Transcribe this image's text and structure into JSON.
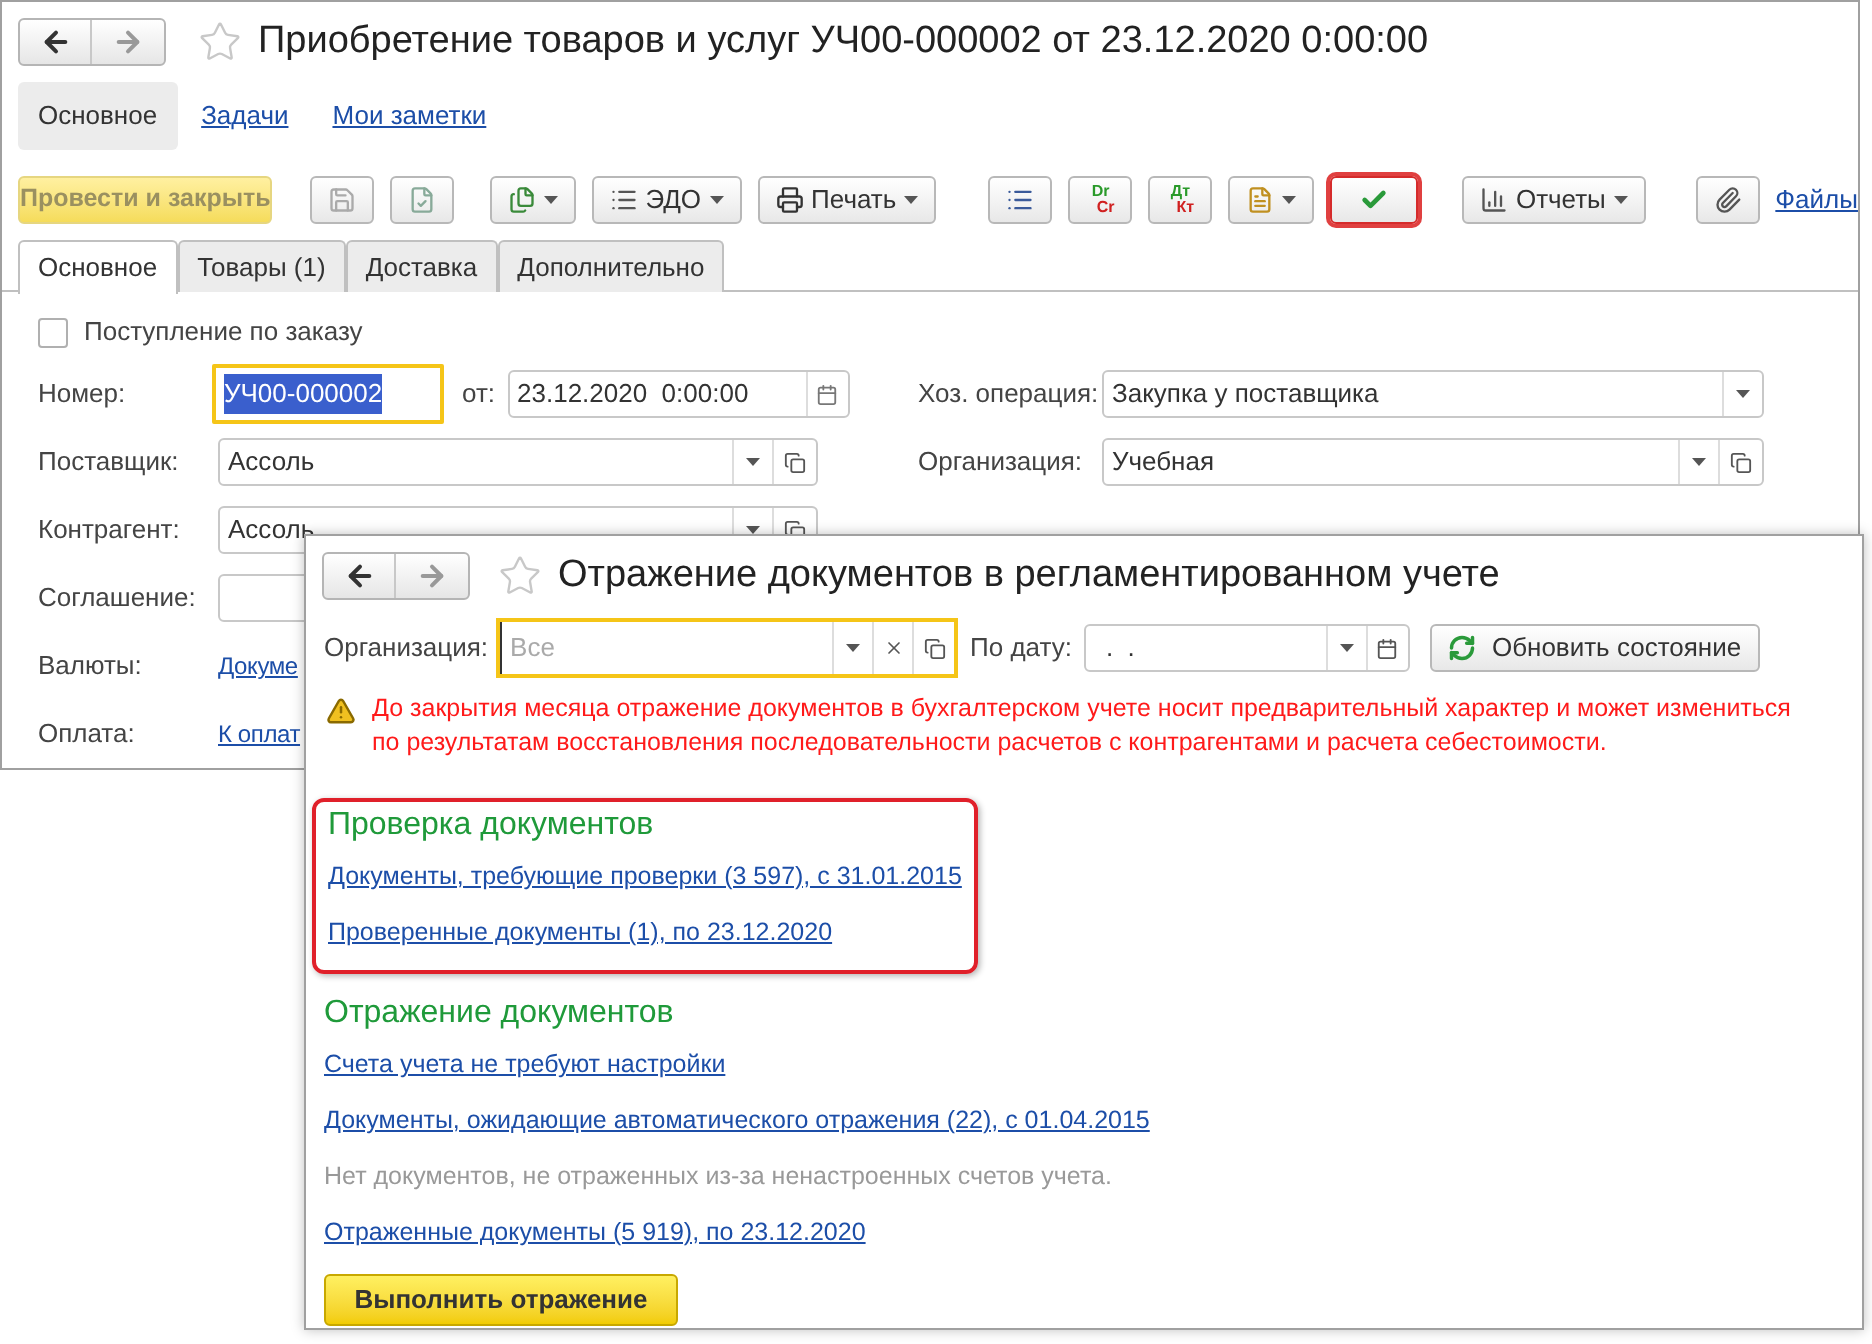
{
  "back_window": {
    "title": "Приобретение товаров и услуг УЧ00-000002 от 23.12.2020 0:00:00",
    "nav_tabs": [
      {
        "label": "Основное",
        "selected": true
      },
      {
        "label": "Задачи",
        "selected": false
      },
      {
        "label": "Мои заметки",
        "selected": false
      }
    ],
    "toolbar": {
      "post_button": "Провести и закрыть",
      "edo_button": "ЭДО",
      "print_button": "Печать",
      "dr_cr": [
        "Dr",
        "Cr"
      ],
      "dt_kt": [
        "Дт",
        "Кт"
      ],
      "check_highlighted": true,
      "reports_button": "Отчеты",
      "files_link": "Файлы"
    },
    "tabs": [
      {
        "label": "Основное",
        "selected": true
      },
      {
        "label": "Товары (1)",
        "selected": false
      },
      {
        "label": "Доставка",
        "selected": false
      },
      {
        "label": "Дополнительно",
        "selected": false
      }
    ],
    "order_checkbox": {
      "label": "Поступление по заказу",
      "checked": false
    },
    "number": {
      "label": "Номер:",
      "value": "УЧ00-000002",
      "focused": true
    },
    "date": {
      "label": "от:",
      "value": "23.12.2020  0:00:00"
    },
    "left_fields": [
      {
        "kind": "select",
        "label": "Поставщик:",
        "value": "Ассоль"
      },
      {
        "kind": "select",
        "label": "Контрагент:",
        "value": "Ассоль"
      },
      {
        "kind": "input",
        "label": "Соглашение:"
      },
      {
        "kind": "link",
        "label": "Валюты:",
        "value": "Докуме"
      },
      {
        "kind": "link",
        "label": "Оплата:",
        "value": "К оплат"
      }
    ],
    "right_fields": [
      {
        "kind": "dropdown",
        "label": "Хоз. операция:",
        "value": "Закупка у поставщика"
      },
      {
        "kind": "select",
        "label": "Организация:",
        "value": "Учебная"
      }
    ]
  },
  "front_window": {
    "title": "Отражение документов в регламентированном учете",
    "organization": {
      "label": "Организация:",
      "placeholder": "Все",
      "focused": true
    },
    "date": {
      "label": "По дату:",
      "value": ".  ."
    },
    "refresh_button": "Обновить состояние",
    "warning": "До закрытия месяца отражение документов в бухгалтерском учете носит предварительный характер и может измениться по результатам восстановления последовательности расчетов с контрагентами и расчета себестоимости.",
    "sections": [
      {
        "title": "Проверка документов",
        "highlighted": true,
        "items": [
          {
            "kind": "link",
            "text": "Документы, требующие проверки (3 597), с 31.01.2015"
          },
          {
            "kind": "link",
            "text": "Проверенные документы (1), по 23.12.2020"
          }
        ]
      },
      {
        "title": "Отражение документов",
        "highlighted": false,
        "items": [
          {
            "kind": "link",
            "text": "Счета учета не требуют настройки"
          },
          {
            "kind": "link",
            "text": "Документы, ожидающие автоматического отражения (22), с 01.04.2015"
          },
          {
            "kind": "note",
            "text": "Нет документов, не отраженных из-за ненастроенных счетов учета."
          },
          {
            "kind": "link",
            "text": "Отраженные документы (5 919), по 23.12.2020"
          }
        ]
      }
    ],
    "run_button": "Выполнить отражение"
  }
}
